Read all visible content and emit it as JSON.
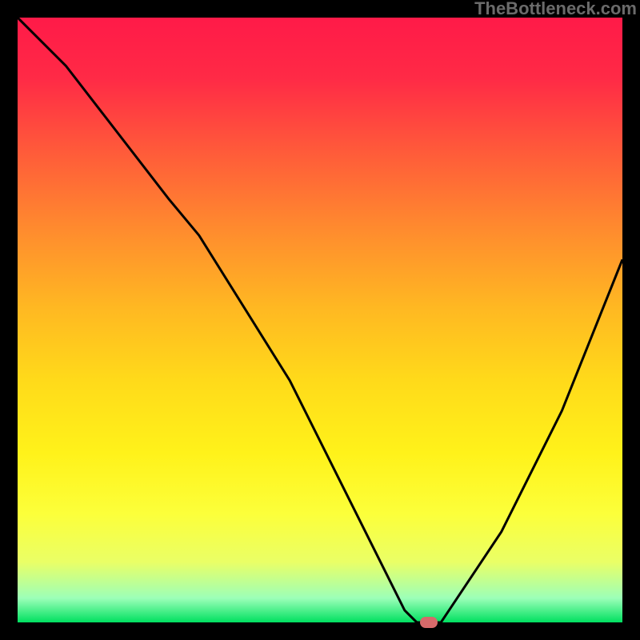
{
  "watermark": "TheBottleneck.com",
  "chart_data": {
    "type": "line",
    "title": "",
    "xlabel": "",
    "ylabel": "",
    "xlim": [
      0,
      100
    ],
    "ylim": [
      0,
      100
    ],
    "grid": false,
    "series": [
      {
        "name": "curve",
        "x": [
          0,
          8,
          25,
          30,
          45,
          55,
          60,
          64,
          66,
          70,
          80,
          90,
          100
        ],
        "y": [
          100,
          92,
          70,
          64,
          40,
          20,
          10,
          2,
          0,
          0,
          15,
          35,
          60
        ]
      }
    ],
    "marker": {
      "x": 68,
      "y": 0
    },
    "background_gradient_stops": [
      {
        "pos": 0,
        "color": "#ff1a48"
      },
      {
        "pos": 35,
        "color": "#ff8b2e"
      },
      {
        "pos": 60,
        "color": "#ffda1a"
      },
      {
        "pos": 90,
        "color": "#eaff66"
      },
      {
        "pos": 100,
        "color": "#00e060"
      }
    ]
  }
}
